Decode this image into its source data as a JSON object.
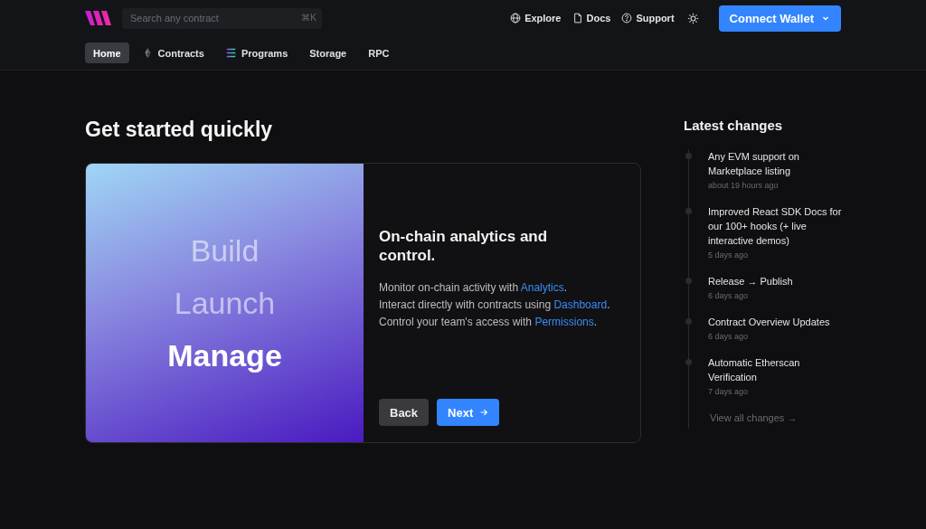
{
  "header": {
    "search": {
      "placeholder": "Search any contract",
      "shortcut": "⌘K"
    },
    "links": [
      {
        "label": "Explore",
        "kind": "globe"
      },
      {
        "label": "Docs",
        "kind": "doc"
      },
      {
        "label": "Support",
        "kind": "help"
      }
    ],
    "connect_button": "Connect Wallet"
  },
  "nav": [
    {
      "label": "Home",
      "kind": "plain",
      "selected": true
    },
    {
      "label": "Contracts",
      "kind": "ethereum",
      "selected": false
    },
    {
      "label": "Programs",
      "kind": "solana",
      "selected": false
    },
    {
      "label": "Storage",
      "kind": "plain",
      "selected": false
    },
    {
      "label": "RPC",
      "kind": "plain",
      "selected": false
    }
  ],
  "title": "Get started quickly",
  "card": {
    "steps": [
      {
        "label": "Build",
        "selected": false
      },
      {
        "label": "Launch",
        "selected": false
      },
      {
        "label": "Manage",
        "selected": true
      }
    ],
    "heading": "On-chain analytics and control.",
    "lines": [
      {
        "text": "Monitor on-chain activity with",
        "link": "Analytics",
        "end": "."
      },
      {
        "text": "Interact directly with contracts using",
        "link": "Dashboard",
        "end": "."
      },
      {
        "text": "Control your team's access with",
        "link": "Permissions",
        "end": "."
      }
    ],
    "back_button": "Back",
    "next_button": "Next"
  },
  "changes": {
    "title": "Latest changes",
    "items": [
      {
        "title": "Any EVM support on Marketplace listing",
        "time": "about 19 hours ago"
      },
      {
        "title": "Improved React SDK Docs for our 100+ hooks (+ live interactive demos)",
        "time": "5 days ago"
      },
      {
        "title": "Release → Publish",
        "time": "6 days ago"
      },
      {
        "title": "Contract Overview Updates",
        "time": "6 days ago"
      },
      {
        "title": "Automatic Etherscan Verification",
        "time": "7 days ago"
      }
    ],
    "view_all": "View all changes →"
  }
}
